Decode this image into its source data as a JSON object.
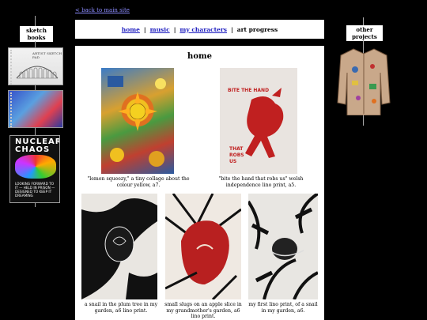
{
  "back_link": "< back to main site",
  "left_sidebar": {
    "label": "sketch books",
    "books": [
      "book-colosseum",
      "book-colorful",
      "book-nuclear-chaos"
    ],
    "book1_text": "ARTIST SKETCH PAD",
    "book3_title": "NUCLEAR CHAOS",
    "book3_text": "LOOKING FORWARD TO IT — HELD IN PRISON — DESIGNED TO KEEP IT DREAMING"
  },
  "right_sidebar": {
    "label": "other projects"
  },
  "nav": {
    "items": [
      "home",
      "music",
      "my characters",
      "art progress"
    ],
    "separator": "|"
  },
  "page": {
    "title": "home"
  },
  "artworks": [
    {
      "caption": "\"lemon squeezy,\" a tiny collage about the colour yellow, a7."
    },
    {
      "caption": "\"bite the hand that robs us\" welsh independence lino print, a5."
    },
    {
      "caption": "a snail in the plum tree in my garden, a6 lino print."
    },
    {
      "caption": "small slugs on an apple slice in my grandmother's garden, a6 lino print."
    },
    {
      "caption": "my first lino print, of a snail in my garden, a6."
    }
  ],
  "art2_text": {
    "line1": "BITE THE HAND",
    "line2": "THAT",
    "line3": "ROBS",
    "line4": "US"
  },
  "colors": {
    "background": "#000000",
    "link": "#2020c0",
    "back_link": "#8c8cff",
    "lino_red": "#c02020"
  }
}
